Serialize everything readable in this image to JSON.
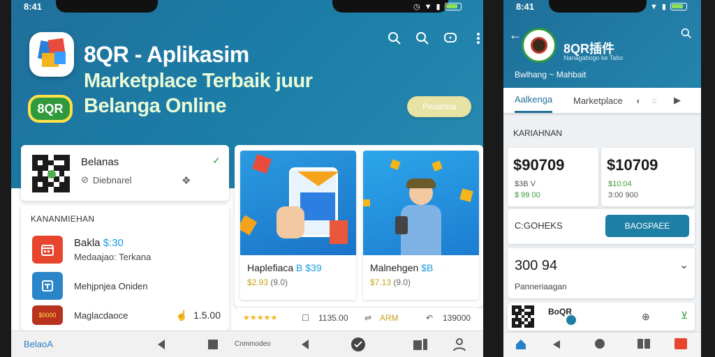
{
  "colors": {
    "hero": "#1b7fa8",
    "accent_green": "#2f9a3c",
    "accent_yellow": "#ffe14a",
    "teal": "#1d7fa3",
    "red": "#e8452e",
    "pill": "#e7e3a4"
  },
  "phoneA": {
    "status": {
      "time": "8:41"
    },
    "hero": {
      "title_line1": "8QR - Aplikasim",
      "title_line2": "Marketplace Terbaik juur",
      "title_line3": "Belanga Online",
      "badge": "8QR",
      "pill_label": "Peoahha"
    },
    "actions": [
      "search-icon",
      "search-icon",
      "chat-icon",
      "more-vert-icon"
    ],
    "qr_card": {
      "title": "Belanas",
      "subtitle": "Diebnarel",
      "check": "✓"
    },
    "list_card": {
      "heading": "KANANMIEHAN",
      "rows": [
        {
          "label": "Bakla",
          "price": "$:30",
          "icon": "calendar-icon",
          "color": "#e8452e"
        },
        {
          "label": "Medaajao: Terkana",
          "icon": "none"
        },
        {
          "label": "Mehjpnjea Oniden",
          "icon": "store-icon",
          "color": "#2a85c9"
        },
        {
          "label": "Maglacdaoce",
          "value": "1.5.00",
          "icon": "card-icon",
          "color": "#b8321e",
          "chip": "$0000"
        }
      ]
    },
    "products": [
      {
        "name": "Haplefiaca",
        "price_tag": "B $39",
        "price": "$2.93",
        "count": "(9.0)"
      },
      {
        "name": "Malnehgen",
        "price_tag": "$B",
        "price": "$7.13",
        "count": "(9.0)"
      }
    ],
    "ratings": {
      "stars": "★★★★★",
      "count": "1135.00",
      "tag": "ARM",
      "value": "139000"
    },
    "nav": {
      "home_label": "BelaoA",
      "center_label": "Cnmmodeo"
    }
  },
  "phoneB": {
    "status": {
      "time": "8:41"
    },
    "header": {
      "title": "8QR插件",
      "subtitle": "Bwlhang ~ Mahbait",
      "caption": "Nanagabogo ke Tabo"
    },
    "tabs": [
      "Aalkenga",
      "Marketplace"
    ],
    "section_title": "KARIAHNAN",
    "prices": [
      {
        "value": "$90709",
        "line1": "$3B V",
        "line2": "$ 99 00"
      },
      {
        "value": "$10709",
        "line1": "$10:04",
        "line2": "3:00 900"
      }
    ],
    "cta_label": "C:GOHEKS",
    "cta_button": "BAOSPAEE",
    "amount": {
      "value": "300 94",
      "label": "Panneriaagan"
    },
    "mini": {
      "label": "BoQR"
    }
  }
}
